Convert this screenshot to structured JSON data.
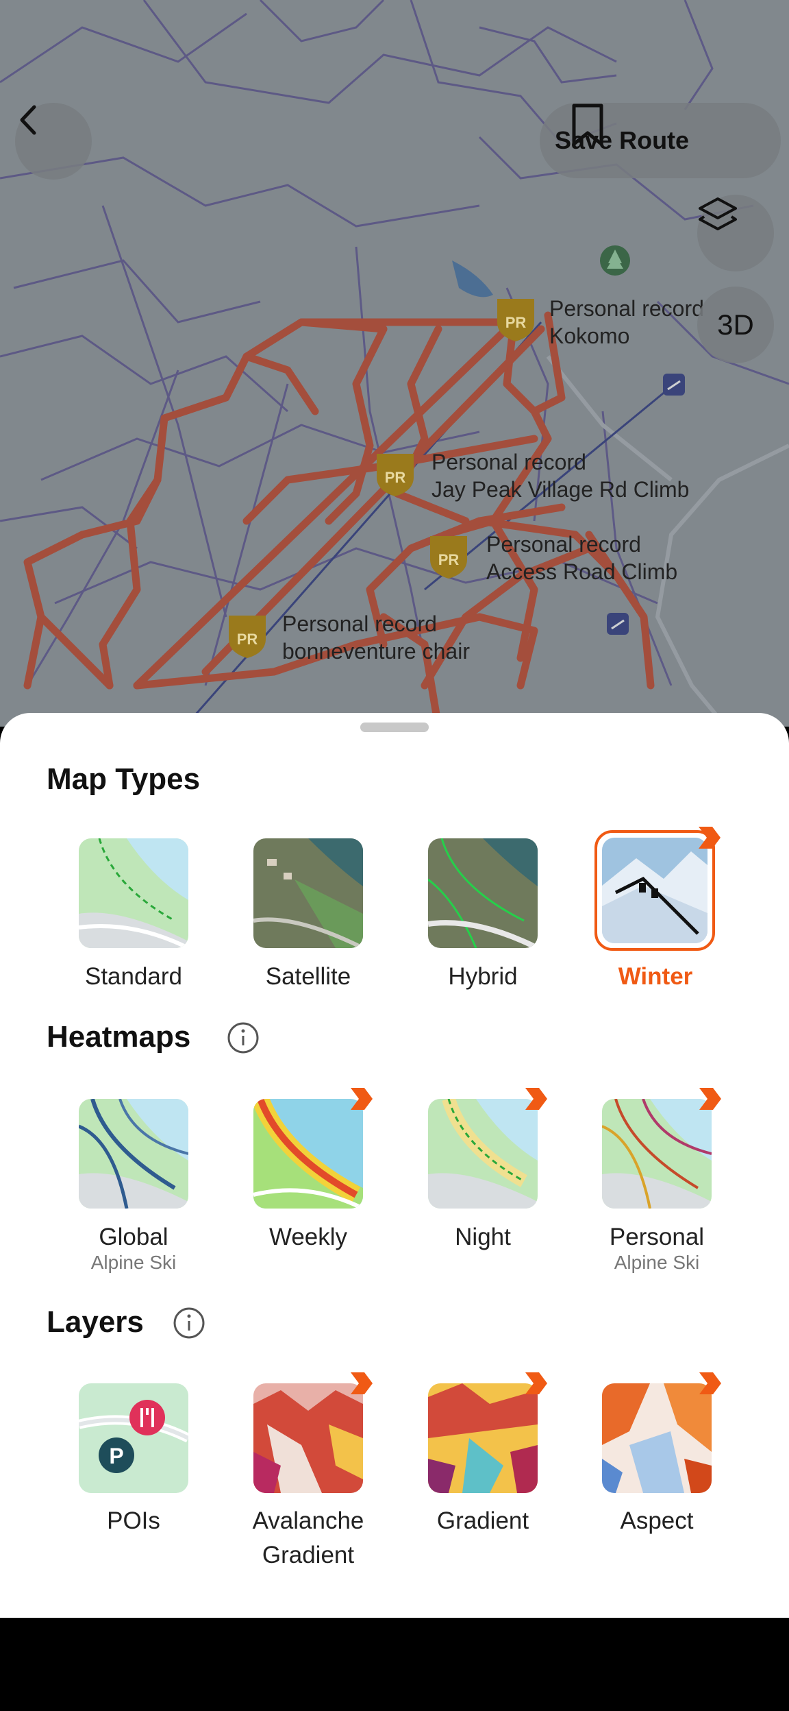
{
  "header": {
    "save_route_label": "Save Route",
    "button_3d_label": "3D"
  },
  "map": {
    "personal_records": [
      {
        "line1": "Personal record",
        "line2": "Kokomo"
      },
      {
        "line1": "Personal record",
        "line2": "Jay Peak Village Rd Climb"
      },
      {
        "line1": "Personal record",
        "line2": "Access Road Climb"
      },
      {
        "line1": "Personal record",
        "line2": "bonneventure chair"
      }
    ],
    "badge_text": "PR"
  },
  "sheet": {
    "map_types_title": "Map Types",
    "heatmaps_title": "Heatmaps",
    "layers_title": "Layers",
    "map_types": [
      {
        "label": "Standard"
      },
      {
        "label": "Satellite"
      },
      {
        "label": "Hybrid"
      },
      {
        "label": "Winter",
        "selected": true,
        "premium": true
      }
    ],
    "heatmaps": [
      {
        "label": "Global",
        "sub": "Alpine Ski"
      },
      {
        "label": "Weekly",
        "premium": true
      },
      {
        "label": "Night",
        "premium": true
      },
      {
        "label": "Personal",
        "sub": "Alpine Ski",
        "premium": true
      }
    ],
    "layers": [
      {
        "label": "POIs"
      },
      {
        "label": "Avalanche",
        "label2": "Gradient",
        "premium": true
      },
      {
        "label": "Gradient",
        "premium": true
      },
      {
        "label": "Aspect",
        "premium": true
      }
    ]
  },
  "colors": {
    "accent": "#f05a14",
    "route": "#c0391b",
    "map_background": "#8a9297"
  },
  "icons": {
    "back": "chevron-left-icon",
    "save": "bookmark-icon",
    "layers": "layers-icon",
    "info": "info-icon",
    "premium": "premium-flag-icon",
    "poi_restaurant": "fork-knife-icon",
    "poi_parking": "parking-icon",
    "tree": "tree-icon",
    "lift": "ski-lift-icon"
  }
}
